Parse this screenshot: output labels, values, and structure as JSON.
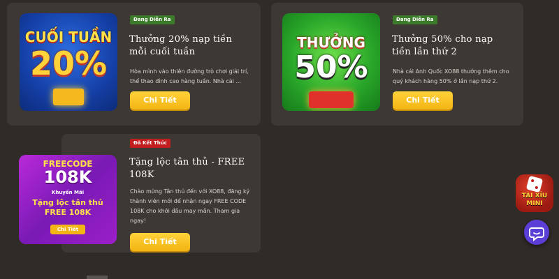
{
  "promos": [
    {
      "status": "Đang Diễn Ra",
      "title": "Thưởng 20% nạp tiền mỗi cuối tuần",
      "description": "Hòa mình vào thiên đường trò chơi giải trí, thể thao đỉnh cao hàng tuần. Nhà cái ...",
      "button": "Chi Tiết",
      "thumb_top": "CUỐI TUẦN",
      "thumb_big": "20%"
    },
    {
      "status": "Đang Diễn Ra",
      "title": "Thưởng 50% cho nạp tiền lần thứ 2",
      "description": "Nhà cái Anh Quốc XO88 thưởng thêm cho quý khách hàng 50% ở lần nạp thứ 2.",
      "button": "Chi Tiết",
      "thumb_top": "THƯỞNG",
      "thumb_big": "50%"
    },
    {
      "status": "Đã Kết Thúc",
      "title": "Tặng lộc tân thủ - FREE 108K",
      "description": "Chào mừng Tân thủ đến với XO88, đăng ký thành viên mới để nhận ngay FREE CODE 108K cho khởi đầu may mắn. Tham gia ngay!",
      "button": "Chi Tiết",
      "thumb_top": "FREECODE",
      "thumb_big": "108K",
      "thumb_sub": "Khuyến Mãi",
      "thumb_line1": "Tặng lộc tân thủ",
      "thumb_line2": "FREE 108K",
      "thumb_btn": "Chi Tiết"
    }
  ],
  "widget": {
    "tai_xiu_line1": "TÀI XỈU",
    "tai_xiu_line2": "MINI"
  },
  "colors": {
    "active_badge": "#3e7a2c",
    "ended_badge": "#c21e1e",
    "button": "#f3b514",
    "chat": "#5b3ed6"
  }
}
